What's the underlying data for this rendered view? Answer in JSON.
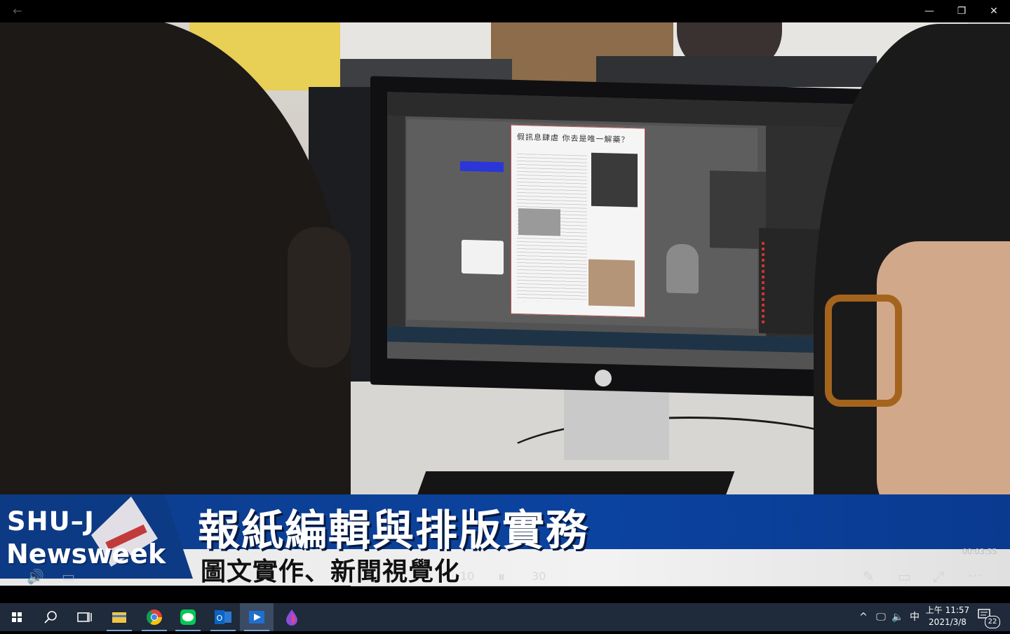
{
  "window": {
    "back_label": "←",
    "minimize": "—",
    "maximize": "❐",
    "close": "✕"
  },
  "video": {
    "screen_headline": "假訊息肆虐 你去是唯一解藥？",
    "brand_line1": "SHU–J",
    "brand_line2": "Newsweek",
    "title": "報紙編輯與排版實務",
    "subtitle": "圖文實作、新聞視覺化",
    "timecode": "00:03:55"
  },
  "player_controls": {
    "volume_icon": "🔊",
    "captions_icon": "▭",
    "rewind_label": "10",
    "play_pause_icon": "⏸",
    "forward_label": "30",
    "edit_icon": "✎",
    "miniview_icon": "▭",
    "fullscreen_icon": "⤢",
    "more_icon": "⋯"
  },
  "taskbar": {
    "apps": [
      "start",
      "search",
      "task-view",
      "file-explorer",
      "chrome",
      "line",
      "outlook",
      "movies-tv",
      "paint-drop"
    ],
    "start_icon": "⊞",
    "search_icon": "⌕",
    "taskview_icon": "⧉",
    "files_icon": "📁",
    "chrome_icon": "◉",
    "line_icon": "LINE",
    "outlook_icon": "O",
    "player_icon": "▶",
    "drop_icon": "💧",
    "tray_up": "^",
    "tray_network": "🖵",
    "tray_volume": "🔈",
    "ime": "中",
    "time": "上午 11:57",
    "date": "2021/3/8",
    "notification_count": "22"
  }
}
